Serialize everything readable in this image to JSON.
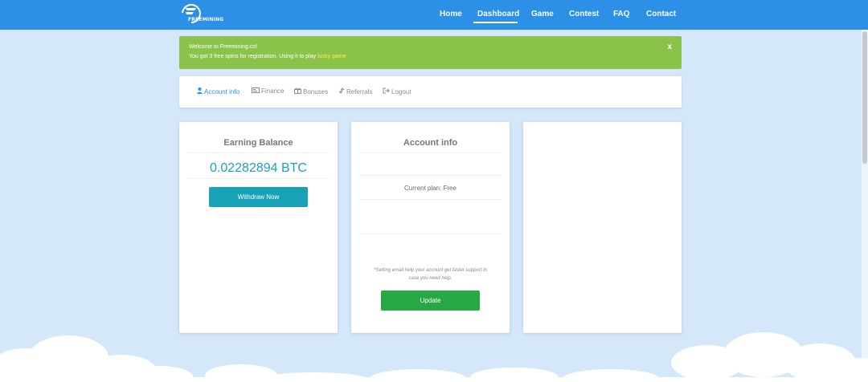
{
  "brand": {
    "logo_text": "FREEMINING",
    "colors": {
      "nav": "#2b90e6",
      "alert": "#8bc34a",
      "withdraw": "#17a2b8",
      "update": "#28a745",
      "active_tab": "#2b90e6"
    }
  },
  "nav": {
    "home": "Home",
    "dashboard": "Dashboard",
    "game": "Game",
    "contest": "Contest",
    "faq": "FAQ",
    "contact": "Contact"
  },
  "alert": {
    "line1": "Welcome to Freemining.co!",
    "line2_prefix": "You got 3 free spins for registration. Using it to play ",
    "line2_link": "lucky game",
    "close": "x"
  },
  "tabs": {
    "account_info": {
      "icon": "user-icon",
      "label": "Account info"
    },
    "finance": {
      "icon": "card-icon",
      "label": "Finance"
    },
    "bonuses": {
      "icon": "gift-icon",
      "label": "Bonuses"
    },
    "referrals": {
      "icon": "link-icon",
      "label": "Referrals"
    },
    "logout": {
      "icon": "sign-out-icon",
      "label": "Logout"
    }
  },
  "earning": {
    "title": "Earning Balance",
    "balance": "0.02282894 BTC",
    "withdraw_label": "Withdraw Now"
  },
  "account": {
    "title": "Account info",
    "plan": "Current plan: Free",
    "note_line1": "*Setting email help your account get faster support in",
    "note_line2": "case you need help.",
    "update_label": "Update"
  }
}
